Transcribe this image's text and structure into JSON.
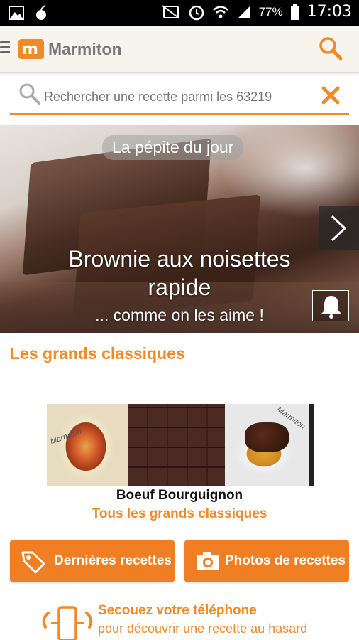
{
  "status_bar": {
    "battery_percent": "77%",
    "time": "17:03"
  },
  "app_bar": {
    "brand": "Marmiton",
    "logo_letter": "m"
  },
  "search": {
    "placeholder": "Rechercher une recette parmi les 63219"
  },
  "hero": {
    "badge": "La pépite du jour",
    "title_line1": "Brownie aux noisettes",
    "title_line2": "rapide",
    "subtitle": "... comme on les aime !"
  },
  "classics": {
    "section_title": "Les grands classiques",
    "current_label": "Boeuf Bourguignon",
    "all_link": "Tous les grands classiques",
    "thumbnails": [
      "terrine",
      "brownies",
      "boeuf-bourguignon",
      "partial"
    ]
  },
  "buttons": {
    "latest": "Dernières recettes",
    "photos": "Photos de recettes"
  },
  "shake": {
    "title": "Secouez votre téléphone",
    "subtitle": "pour découvrir une recette au hasard"
  },
  "colors": {
    "accent": "#f08a26",
    "app_bar_bg": "#f7f4ee"
  }
}
